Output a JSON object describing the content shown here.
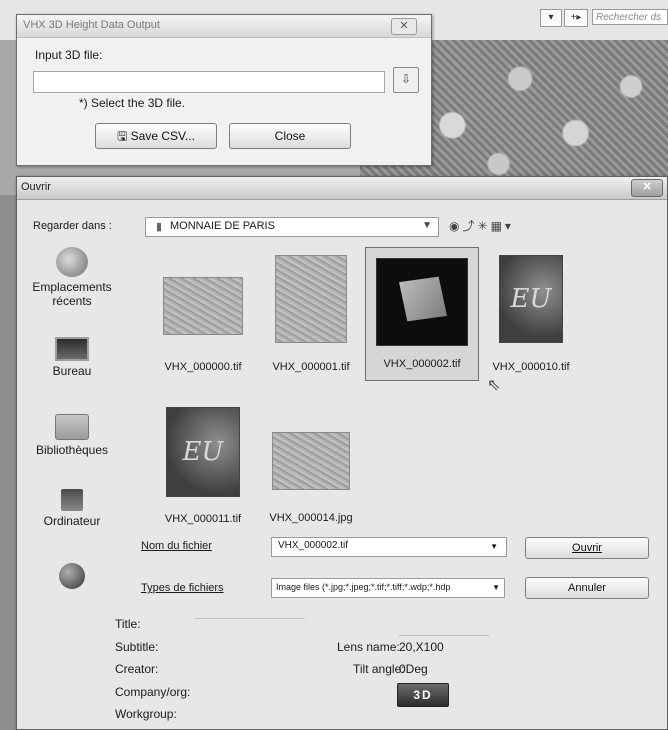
{
  "background": {
    "search": {
      "placeholder": "Rechercher ds"
    },
    "nav_buttons": [
      "▾",
      "+▸"
    ]
  },
  "vhx_dialog": {
    "title": "VHX 3D Height Data Output",
    "close_glyph": "✕",
    "input_label": "Input 3D file:",
    "file_value": "",
    "browse_glyph": "⇩",
    "hint": "*) Select the 3D file.",
    "save_button": "Save CSV...",
    "close_button": "Close"
  },
  "open_dialog": {
    "title": "Ouvrir",
    "close_glyph": "✕",
    "look_in_label": "Regarder dans :",
    "look_in_value": "MONNAIE DE PARIS",
    "places": [
      {
        "label": "Emplacements\nrécents",
        "icon": "recent-places-icon"
      },
      {
        "label": "Bureau",
        "icon": "desktop-icon"
      },
      {
        "label": "Bibliothèques",
        "icon": "libraries-icon"
      },
      {
        "label": "Ordinateur",
        "icon": "computer-icon"
      },
      {
        "label": "",
        "icon": "network-icon"
      }
    ],
    "files": [
      {
        "name": "VHX_000000.tif",
        "thumb_text": ""
      },
      {
        "name": "VHX_000001.tif",
        "thumb_text": ""
      },
      {
        "name": "VHX_000002.tif",
        "thumb_text": "",
        "selected": true
      },
      {
        "name": "VHX_000010.tif",
        "thumb_text": "EU"
      },
      {
        "name": "VHX_000011.tif",
        "thumb_text": "EU"
      },
      {
        "name": "VHX_000014.jpg",
        "thumb_text": ""
      }
    ],
    "file_name_label": "Nom du fichier",
    "file_name_value": "VHX_000002.tif",
    "file_type_label": "Types de fichiers",
    "file_type_value": "Image files (*.jpg;*.jpeg;*.tif;*.tiff;*.wdp;*.hdp",
    "open_button": "Ouvrir",
    "cancel_button": "Annuler"
  },
  "metadata": {
    "title_label": "Title:",
    "subtitle_label": "Subtitle:",
    "creator_label": "Creator:",
    "company_label": "Company/org:",
    "workgroup_label": "Workgroup:",
    "lens_label": "Lens name:",
    "lens_value": "20,X100",
    "tilt_label": "Tilt angle:",
    "tilt_value": "0Deg",
    "button_3d": "3D"
  },
  "colors": {
    "dialog_bg": "#e7e7e7",
    "selection": "#d6d6d6",
    "button_3d": "#3a3a3a"
  }
}
